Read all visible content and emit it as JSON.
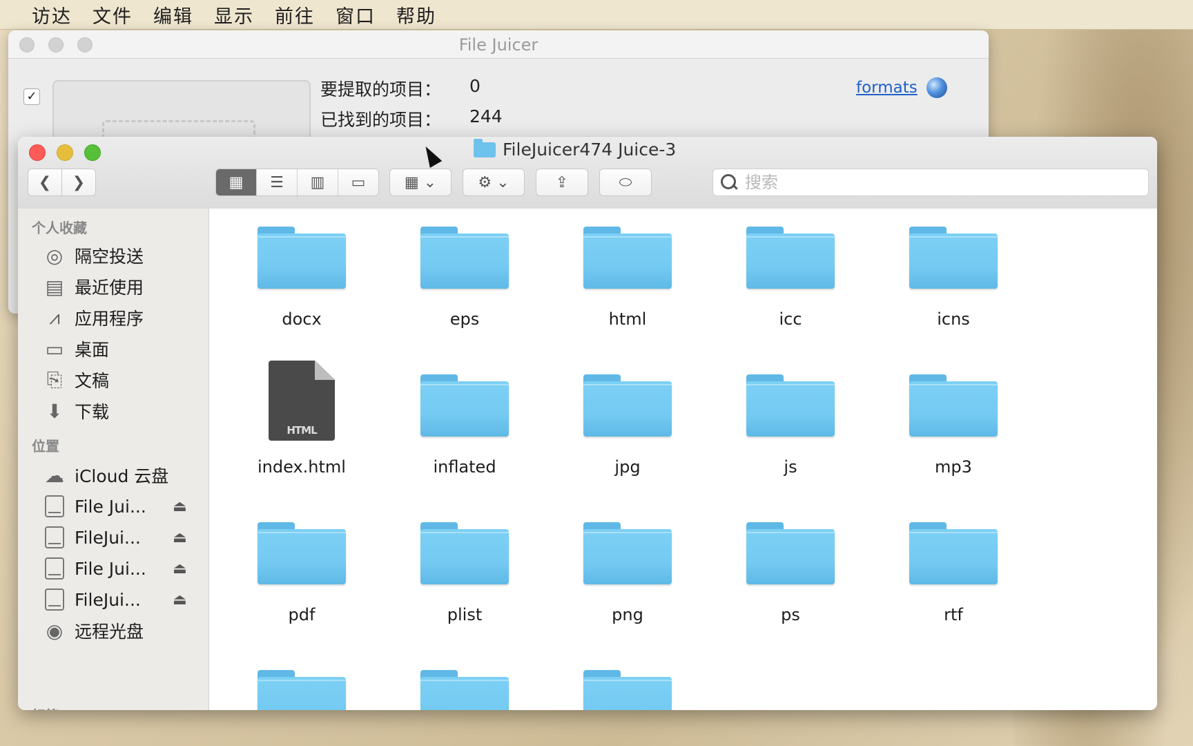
{
  "menubar": {
    "items": [
      "访达",
      "文件",
      "编辑",
      "显示",
      "前往",
      "窗口",
      "帮助"
    ]
  },
  "file_juicer": {
    "title": "File Juicer",
    "label_to_extract": "要提取的项目：",
    "value_to_extract": "0",
    "label_found": "已找到的项目：",
    "value_found": "244",
    "formats_link": "formats"
  },
  "finder": {
    "title": "FileJuicer474 Juice-3",
    "search_placeholder": "搜索",
    "sidebar": {
      "favorites_header": "个人收藏",
      "favorites": [
        "隔空投送",
        "最近使用",
        "应用程序",
        "桌面",
        "文稿",
        "下载"
      ],
      "locations_header": "位置",
      "locations": [
        "iCloud 云盘",
        "File Jui...",
        "FileJui...",
        "File Jui...",
        "FileJui...",
        "远程光盘"
      ],
      "tags_header": "标签"
    },
    "items": [
      {
        "name": "docx",
        "kind": "folder"
      },
      {
        "name": "eps",
        "kind": "folder"
      },
      {
        "name": "html",
        "kind": "folder"
      },
      {
        "name": "icc",
        "kind": "folder"
      },
      {
        "name": "icns",
        "kind": "folder"
      },
      {
        "name": "index.html",
        "kind": "file",
        "badge": "HTML"
      },
      {
        "name": "inflated",
        "kind": "folder"
      },
      {
        "name": "jpg",
        "kind": "folder"
      },
      {
        "name": "js",
        "kind": "folder"
      },
      {
        "name": "mp3",
        "kind": "folder"
      },
      {
        "name": "pdf",
        "kind": "folder"
      },
      {
        "name": "plist",
        "kind": "folder"
      },
      {
        "name": "png",
        "kind": "folder"
      },
      {
        "name": "ps",
        "kind": "folder"
      },
      {
        "name": "rtf",
        "kind": "folder"
      },
      {
        "name": "",
        "kind": "folder"
      },
      {
        "name": "",
        "kind": "folder"
      },
      {
        "name": "",
        "kind": "folder"
      }
    ]
  },
  "colors": {
    "folder": "#74caf2",
    "close": "#fc5b57",
    "minimize": "#e5bf3c",
    "zoom": "#57c038",
    "link": "#1e5fc9"
  }
}
